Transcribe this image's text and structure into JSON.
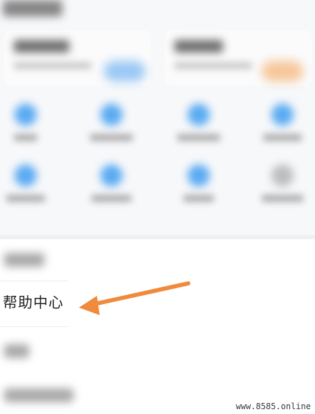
{
  "help_center": {
    "label": "帮助中心"
  },
  "arrow": {
    "color": "#F08A3C",
    "direction": "points-left-to-help-center"
  },
  "watermark": {
    "text": "www.8585.online"
  },
  "colors": {
    "accent_blue": "#5AAAF2",
    "accent_orange": "#F6C79B",
    "background": "#F7F8FA"
  }
}
